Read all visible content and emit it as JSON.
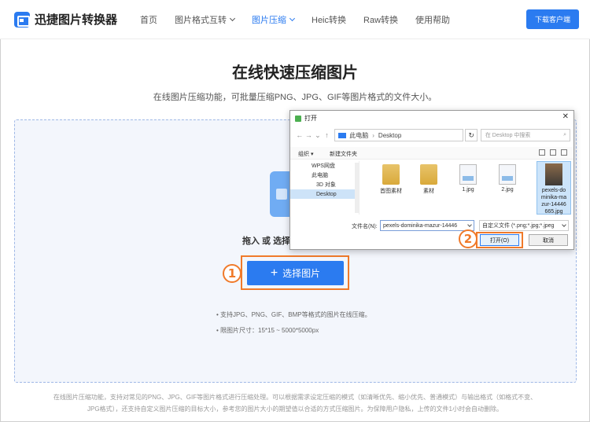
{
  "header": {
    "logo_text": "迅捷图片转换器",
    "nav": [
      {
        "label": "首页",
        "dropdown": false,
        "active": false
      },
      {
        "label": "图片格式互转",
        "dropdown": true,
        "active": false
      },
      {
        "label": "图片压缩",
        "dropdown": true,
        "active": true
      },
      {
        "label": "Heic转换",
        "dropdown": false,
        "active": false
      },
      {
        "label": "Raw转换",
        "dropdown": false,
        "active": false
      },
      {
        "label": "使用帮助",
        "dropdown": false,
        "active": false
      }
    ],
    "download_label": "下载客户端"
  },
  "main": {
    "title": "在线快速压缩图片",
    "subtitle": "在线图片压缩功能，可批量压缩PNG、JPG、GIF等图片格式的文件大小。",
    "drag_hint": "拖入 或 选择",
    "select_label": "选择图片",
    "notes": [
      "• 支持JPG、PNG、GIF、BMP等格式的图片在线压缩。",
      "• 限图片尺寸：15*15 ~ 5000*5000px"
    ],
    "step1": "1",
    "step2": "2"
  },
  "footer": {
    "line1": "在线图片压缩功能，支持对常见的PNG、JPG、GIF等图片格式进行压缩处理。可以根据需求设定压缩的模式（如清晰优先、缩小优先、普通模式）与输出格式（如格式不变、",
    "line2": "JPG格式），还支持自定义图片压缩的目标大小，参考您的图片大小的期望值以合适的方式压缩图片。为保障用户隐私，上传的文件1小时会自动删除。"
  },
  "dialog": {
    "title": "打开",
    "close": "✕",
    "breadcrumb": [
      "此电脑",
      "Desktop"
    ],
    "search_placeholder": "在 Desktop 中搜索",
    "organize": "组织 ▾",
    "new_folder": "新建文件夹",
    "nav_items": [
      {
        "label": "WPS网盘",
        "color": "#3d8fe8"
      },
      {
        "label": "此电脑",
        "color": "#5c8fd6"
      },
      {
        "label": "3D 对象",
        "color": "#59b2e8"
      },
      {
        "label": "Desktop",
        "color": "#3d7fd8"
      }
    ],
    "files": [
      {
        "name": "首图素材",
        "kind": "folder"
      },
      {
        "name": "素材",
        "kind": "folder"
      },
      {
        "name": "1.jpg",
        "kind": "image"
      },
      {
        "name": "2.jpg",
        "kind": "image"
      }
    ],
    "selected_file": "pexels-dominika-mazur-14446665.jpg",
    "selected_file_display": [
      "pexels-do",
      "minika-ma",
      "zur-14446",
      "665.jpg"
    ],
    "filename_label": "文件名(N):",
    "filename_value": "pexels-dominika-mazur-14446",
    "filetype_value": "自定义文件 (*.png;*.jpg;*.jpeg",
    "open_label": "打开(O)",
    "cancel_label": "取消"
  },
  "colors": {
    "accent": "#2b7bf0",
    "highlight": "#f07a2a"
  }
}
